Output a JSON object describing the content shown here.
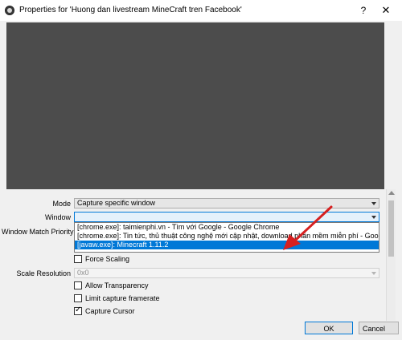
{
  "window": {
    "title": "Properties for 'Huong dan livestream MineCraft tren Facebook'",
    "help": "?",
    "close": "✕"
  },
  "form": {
    "mode_label": "Mode",
    "mode_value": "Capture specific window",
    "window_label": "Window",
    "window_value": "",
    "priority_label": "Window Match Priority",
    "window_options": [
      "[chrome.exe]: taimienphi.vn - Tìm với Google - Google Chrome",
      "[chrome.exe]: Tin tức, thủ thuật công nghệ mới cập nhật, download phần mềm miễn phí - Google Chrome",
      "[javaw.exe]: Minecraft 1.11.2"
    ],
    "selected_option_index": 2,
    "force_scaling": {
      "label": "Force Scaling",
      "checked": false
    },
    "scale_label": "Scale Resolution",
    "scale_value": "0x0",
    "allow_transparency": {
      "label": "Allow Transparency",
      "checked": false
    },
    "limit_framerate": {
      "label": "Limit capture framerate",
      "checked": false
    },
    "capture_cursor": {
      "label": "Capture Cursor",
      "checked": true
    }
  },
  "buttons": {
    "ok": "OK",
    "cancel": "Cancel"
  },
  "colors": {
    "preview_bg": "#4c4c4c",
    "selection": "#0078d7",
    "annotation_arrow": "#d62020"
  }
}
